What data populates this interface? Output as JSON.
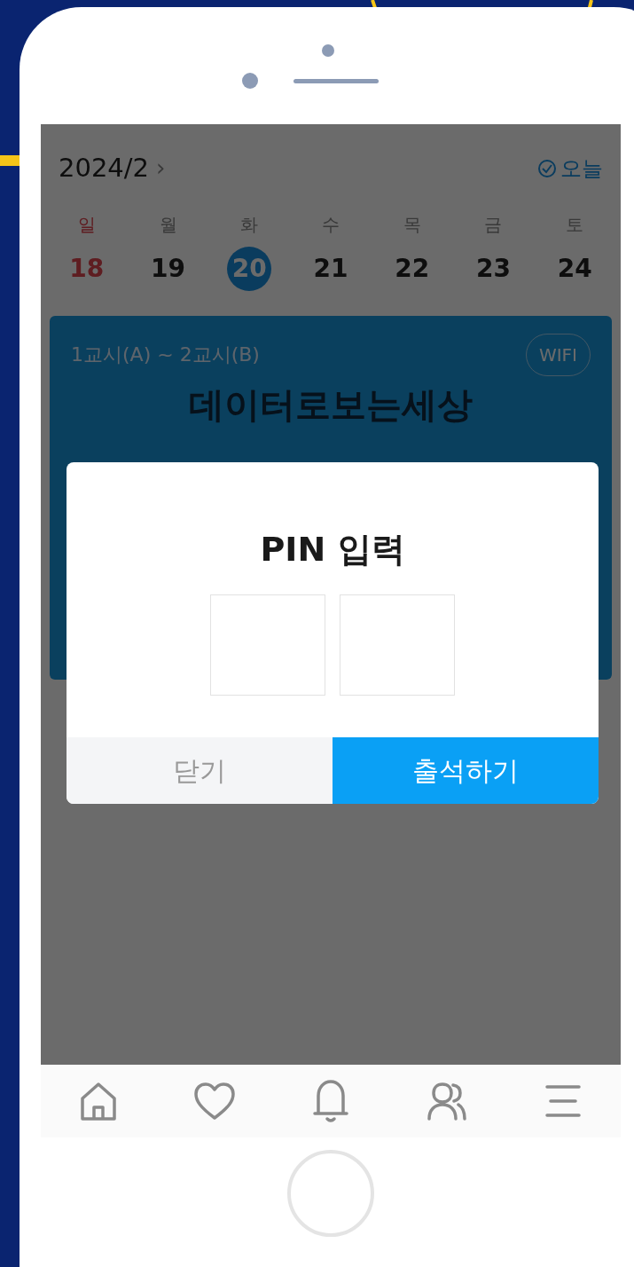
{
  "header": {
    "month": "2024/2",
    "chevron": "›",
    "today": "오늘"
  },
  "week": [
    {
      "weekday": "일",
      "date": "18",
      "holiday": true,
      "selected": false
    },
    {
      "weekday": "월",
      "date": "19",
      "holiday": false,
      "selected": false
    },
    {
      "weekday": "화",
      "date": "20",
      "holiday": false,
      "selected": true
    },
    {
      "weekday": "수",
      "date": "21",
      "holiday": false,
      "selected": false
    },
    {
      "weekday": "목",
      "date": "22",
      "holiday": false,
      "selected": false
    },
    {
      "weekday": "금",
      "date": "23",
      "holiday": false,
      "selected": false
    },
    {
      "weekday": "토",
      "date": "24",
      "holiday": false,
      "selected": false
    }
  ],
  "class_card": {
    "period": "1교시(A) ~ 2교시(B)",
    "badge": "WIFI",
    "title": "데이터로보는세상"
  },
  "dialog": {
    "title": "PIN 입력",
    "pin_fields": [
      {
        "filled": false
      },
      {
        "filled": false
      }
    ],
    "buttons": [
      {
        "label": "닫기",
        "kind": "secondary"
      },
      {
        "label": "출석하기",
        "kind": "primary"
      }
    ]
  },
  "nav": [
    {
      "kind": "home"
    },
    {
      "kind": "heart"
    },
    {
      "kind": "bell"
    },
    {
      "kind": "people"
    },
    {
      "kind": "menu"
    }
  ]
}
